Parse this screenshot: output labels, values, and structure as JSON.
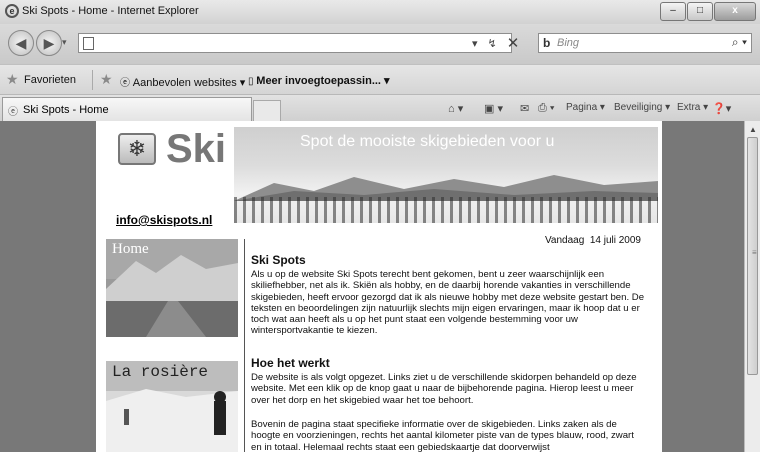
{
  "window": {
    "title": "Ski Spots - Home - Internet Explorer"
  },
  "address_bar": {
    "url": "",
    "search_placeholder": "Bing"
  },
  "favorites_bar": {
    "favorites_label": "Favorieten",
    "suggested_label": "Aanbevolen websites ▾",
    "addons_label": "Meer invoegtoepassin... ▾"
  },
  "tab": {
    "title": "Ski Spots - Home"
  },
  "command_bar": {
    "page": "Pagina ▾",
    "security": "Beveiliging ▾",
    "extra": "Extra ▾"
  },
  "site": {
    "logo_text": "Ski",
    "tagline": "Spot de mooiste skigebieden voor u",
    "email": "info@skispots.nl",
    "date_label": "Vandaag",
    "date_value": "14 juli 2009",
    "nav": [
      {
        "label": "Home"
      },
      {
        "label": "La rosière"
      }
    ],
    "sections": [
      {
        "heading": "Ski Spots",
        "text": "Als u op de website Ski Spots terecht bent gekomen, bent u zeer waarschijnlijk een skiliefhebber, net als ik. Skiën als hobby, en de daarbij horende vakanties in verschillende skigebieden, heeft ervoor gezorgd dat ik als nieuwe hobby met deze website gestart ben. De teksten en beoordelingen zijn natuurlijk slechts mijn eigen ervaringen, maar ik hoop dat u er toch wat aan heeft als u op het punt staat een volgende bestemming voor uw wintersportvakantie te kiezen."
      },
      {
        "heading": "Hoe het werkt",
        "text": "De website is als volgt opgezet. Links ziet u de verschillende skidorpen behandeld op deze website. Met een klik op de knop gaat u naar de bijbehorende pagina. Hierop leest u meer over het dorp en het skigebied waar het toe behoort.",
        "text2": "Bovenin de pagina staat specifieke informatie over de skigebieden. Links zaken als de hoogte en voorzieningen, rechts het aantal kilometer piste van de types blauw, rood, zwart en in totaal. Helemaal rechts staat een gebiedskaartje dat doorverwijst"
      }
    ]
  }
}
